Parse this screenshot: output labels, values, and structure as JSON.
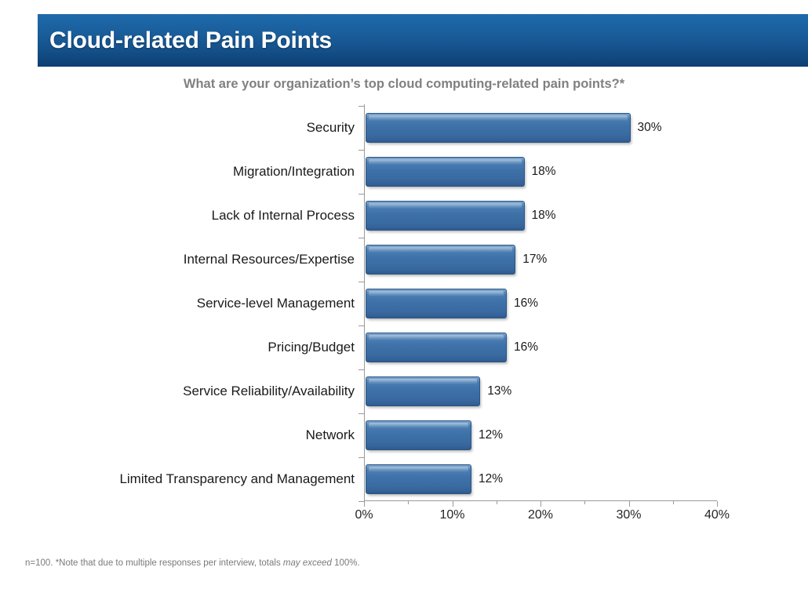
{
  "slide": {
    "title": "Cloud-related Pain Points",
    "subtitle": "What are your organization’s top cloud computing-related pain points?*",
    "footnote_pre": "n=100. *Note that due to multiple responses per interview, totals ",
    "footnote_em": "may exceed",
    "footnote_post": " 100%.",
    "banner_color": "#15528c",
    "bar_color": "#3d71a8",
    "subtitle_color": "#808080"
  },
  "chart_data": {
    "type": "bar",
    "orientation": "horizontal",
    "title": "What are your organization’s top cloud computing-related pain points?*",
    "xlabel": "",
    "ylabel": "",
    "xlim": [
      0,
      40
    ],
    "grid": false,
    "legend": false,
    "categories": [
      "Security",
      "Migration/Integration",
      "Lack of Internal Process",
      "Internal Resources/Expertise",
      "Service-level Management",
      "Pricing/Budget",
      "Service Reliability/Availability",
      "Network",
      "Limited Transparency and Management"
    ],
    "values": [
      30,
      18,
      18,
      17,
      16,
      16,
      13,
      12,
      12
    ],
    "value_labels": [
      "30%",
      "18%",
      "18%",
      "17%",
      "16%",
      "16%",
      "13%",
      "12%",
      "12%"
    ],
    "xticks": [
      0,
      10,
      20,
      30,
      40
    ],
    "xtick_labels": [
      "0%",
      "10%",
      "20%",
      "30%",
      "40%"
    ],
    "xticks_minor": [
      5,
      15,
      25,
      35
    ]
  }
}
